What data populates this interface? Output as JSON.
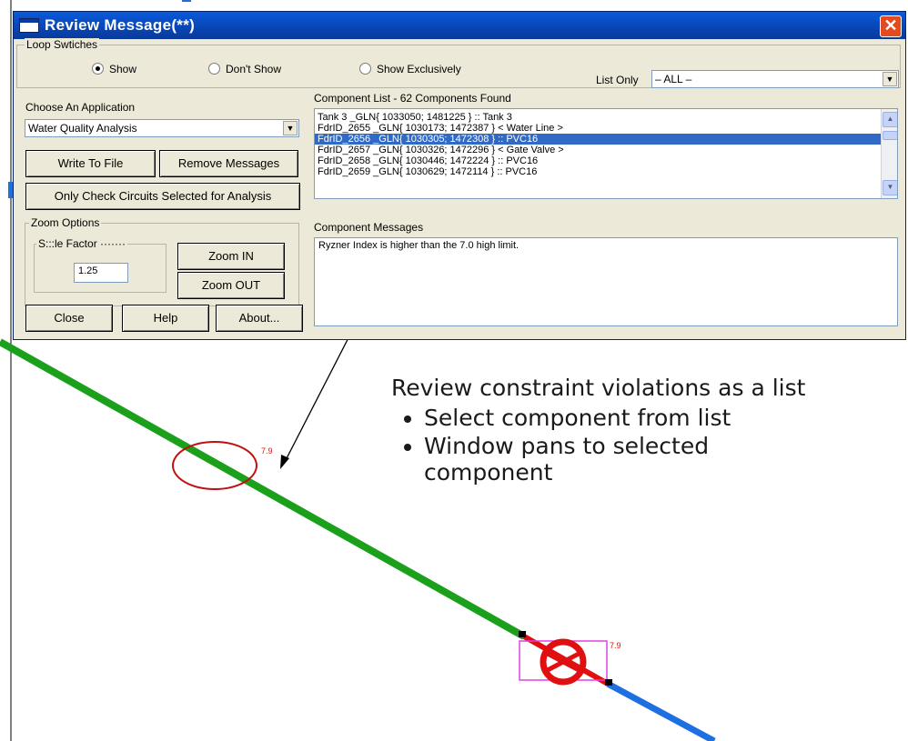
{
  "window": {
    "title": "Review Message(**)",
    "close_glyph": "✕"
  },
  "loop_switches": {
    "label": "Loop Swtiches",
    "options": [
      "Show",
      "Don't Show",
      "Show Exclusively"
    ],
    "selected": "Show"
  },
  "list_only": {
    "label": "List Only",
    "value": "– ALL –"
  },
  "application": {
    "label": "Choose An Application",
    "value": "Water Quality Analysis"
  },
  "buttons": {
    "write_to_file": "Write To File",
    "remove_messages": "Remove Messages",
    "only_check": "Only Check Circuits Selected for Analysis",
    "zoom_in": "Zoom IN",
    "zoom_out": "Zoom OUT",
    "close": "Close",
    "help": "Help",
    "about": "About..."
  },
  "zoom_options": {
    "label": "Zoom Options",
    "scale_label": "S:::le Factor ·······",
    "scale_value": "1.25"
  },
  "component_list": {
    "label": "Component List - 62 Components Found",
    "items": [
      "Tank 3 _GLN{ 1033050; 1481225 } :: Tank 3",
      "FdrID_2655 _GLN{ 1030173; 1472387 } < Water Line >",
      "FdrID_2656 _GLN{ 1030305; 1472308 } :: PVC16",
      "FdrID_2657 _GLN{ 1030326; 1472296 } < Gate Valve >",
      "FdrID_2658 _GLN{ 1030446; 1472224 } :: PVC16",
      "FdrID_2659 _GLN{ 1030629; 1472114 } :: PVC16"
    ],
    "selected_index": 2
  },
  "component_messages": {
    "label": "Component Messages",
    "text": "Ryzner Index is higher than the 7.0 high limit."
  },
  "annotation": {
    "heading": "Review constraint violations as a list",
    "bullets": [
      "Select component from list",
      "Window pans to selected component"
    ]
  },
  "map": {
    "label_1": "7.9",
    "label_2": "7.9",
    "colors": {
      "water_line": "#1aa01a",
      "pipe_blue": "#1e6fe0",
      "highlight": "#e01010",
      "selection_box": "#e040e0"
    }
  }
}
